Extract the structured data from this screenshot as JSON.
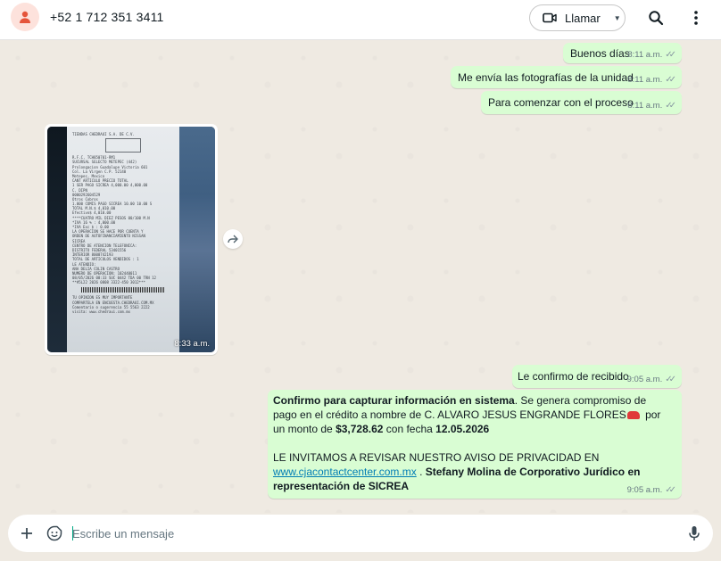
{
  "header": {
    "phone": "+52 1 712 351 3411",
    "call_label": "Llamar"
  },
  "messages": [
    {
      "text": "Buenos días",
      "time": "8:11 a.m."
    },
    {
      "text": "Me envía las fotografías de la unidad",
      "time": "8:11 a.m."
    },
    {
      "text": "Para comenzar con el proceso",
      "time": "8:11 a.m."
    }
  ],
  "image_message": {
    "time": "8:33 a.m.",
    "receipt_lines": [
      "TIENDAS CHEDRAUI S.A. DE C.V.",
      "R.F.C. TCH850701-RM1",
      "SUCURSAL SELECTO METEPEC (442)",
      "Prolongacion Guadalupe Victoria 601",
      "Col. La Virgen C.P. 52140",
      "Metepec, Mexico",
      "CANT  ARTICULO      PRECIO  TOTAL",
      "1 SER PAGO SICREA  4,000.00 4,000.00",
      "C. DIPN",
      "0000292604529",
      "Otros Cobros",
      "1.000 COMIS PAGO SICREA  10.00  10.00 S",
      "       TOTAL M.N.$ 4,010.00",
      "       Efectivo$ 4,010.00",
      "****CUATRO MIL DIEZ PESOS 00/100 M.N",
      "*IVA  16  % :        4,000.00",
      "*IVA Exc $  :           0.00",
      "LA OPERACION SE HACE POR CUENTA Y",
      "ORDEN DE AUTOFINANCIAMIENTO NISSAN",
      "SICREA",
      "CENTRO DE ATENCION TELEFONICA:",
      "DISTRITO FEDERAL 53401556",
      "INTERIOR 8008742193",
      "TOTAL DE ARTICULOS VENDIDOS : 1",
      "LE ATENDIO:",
      "ANA DELIA COLIN CASTRO",
      "NUMERO DE OPERACION: 102440011",
      "08/05/2026 08:33 SUC 0442 TDA 00 TRN 12",
      "**#5L22 2026 0808 3322-450 3012***",
      "TU OPINION ES MUY IMPORTANTE",
      "COMPARTELA EN ENCUESTA.CHEDRAUI.COM.MX",
      "Comentario o sugerencia 55 5563 2222",
      "visita: www.chedraui.com.mx"
    ]
  },
  "messages_late": [
    {
      "text": "Le confirmo de recibido",
      "time": "9:05 a.m."
    }
  ],
  "long_message": {
    "bold_lead": "Confirmo para capturar información en sistema",
    "p1_rest": ". Se genera compromiso de pago en el crédito a nombre de C. ALVARO JESUS ENGRANDE FLORES",
    "p1_mid": " por un monto de ",
    "amount": "$3,728.62",
    "p1_date_pre": " con fecha ",
    "date": "12.05.2026",
    "p2_line": "LE INVITAMOS A REVISAR NUESTRO AVISO DE PRIVACIDAD EN",
    "link": "www.cjacontactcenter.com.mx",
    "p2_mid": " . ",
    "signature": "Stefany Molina de Corporativo Jurídico en representación de SICREA",
    "time": "9:05 a.m."
  },
  "composer": {
    "placeholder": "Escribe un mensaje"
  },
  "colors": {
    "outgoing_bubble": "#d9fdd3",
    "chat_background": "#efeae2",
    "link": "#027eb5",
    "accent": "#00a884"
  },
  "icons": [
    "person-icon",
    "video-icon",
    "search-icon",
    "kebab-menu-icon",
    "double-check-icon",
    "forward-icon",
    "plus-icon",
    "emoji-icon",
    "mic-icon",
    "car-emoji"
  ]
}
